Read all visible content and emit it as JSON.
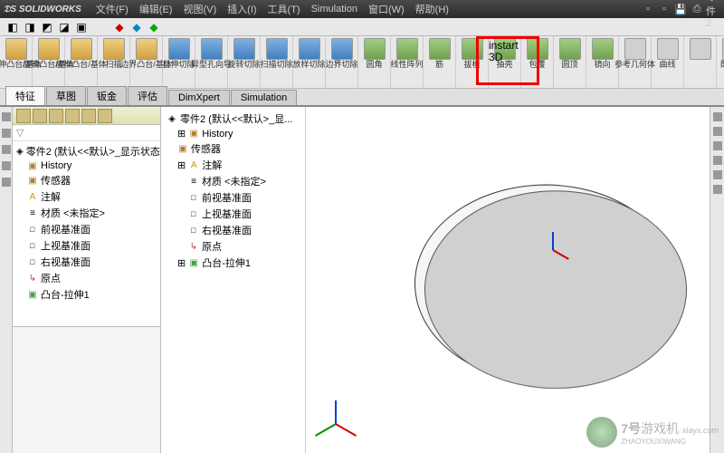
{
  "app": {
    "name": "SOLIDWORKS",
    "doc_title": "零件2"
  },
  "menu": [
    "文件(F)",
    "编辑(E)",
    "视图(V)",
    "插入(I)",
    "工具(T)",
    "Simulation",
    "窗口(W)",
    "帮助(H)"
  ],
  "ribbon": [
    {
      "label": "拉伸凸台/基体"
    },
    {
      "label": "旋转凸台/基体"
    },
    {
      "label": "放样凸台/基体"
    },
    {
      "label": "扫描"
    },
    {
      "label": "边界凸台/基体"
    },
    {
      "label": "拉伸切除"
    },
    {
      "label": "异型孔向导"
    },
    {
      "label": "旋转切除"
    },
    {
      "label": "扫描切除"
    },
    {
      "label": "放样切除"
    },
    {
      "label": "边界切除"
    },
    {
      "label": "圆角"
    },
    {
      "label": "线性阵列"
    },
    {
      "label": "筋"
    },
    {
      "label": "拔模"
    },
    {
      "label": "抽壳"
    },
    {
      "label": "包覆"
    },
    {
      "label": "圆顶"
    },
    {
      "label": "镜向"
    },
    {
      "label": "参考几何体"
    },
    {
      "label": "曲线"
    },
    {
      "label": "配合参"
    }
  ],
  "highlight": {
    "l1": "instart",
    "l2": "3D"
  },
  "tabs": [
    "特征",
    "草图",
    "钣金",
    "评估",
    "DimXpert",
    "Simulation"
  ],
  "tree_root": "零件2 (默认<<默认>_显示状态",
  "tree": [
    {
      "icon": "folder",
      "label": "History"
    },
    {
      "icon": "folder",
      "label": "传感器"
    },
    {
      "icon": "note",
      "label": "注解"
    },
    {
      "icon": "mat",
      "label": "材质 <未指定>"
    },
    {
      "icon": "plane",
      "label": "前视基准面"
    },
    {
      "icon": "plane",
      "label": "上视基准面"
    },
    {
      "icon": "plane",
      "label": "右视基准面"
    },
    {
      "icon": "origin",
      "label": "原点"
    },
    {
      "icon": "feat",
      "label": "凸台-拉伸1"
    }
  ],
  "secondary_root": "零件2 (默认<<默认>_显...",
  "watermark": {
    "num": "7号",
    "text": "游戏机",
    "sub": "ZHAOYOUXIWANG",
    "url": "xiayx.com"
  }
}
